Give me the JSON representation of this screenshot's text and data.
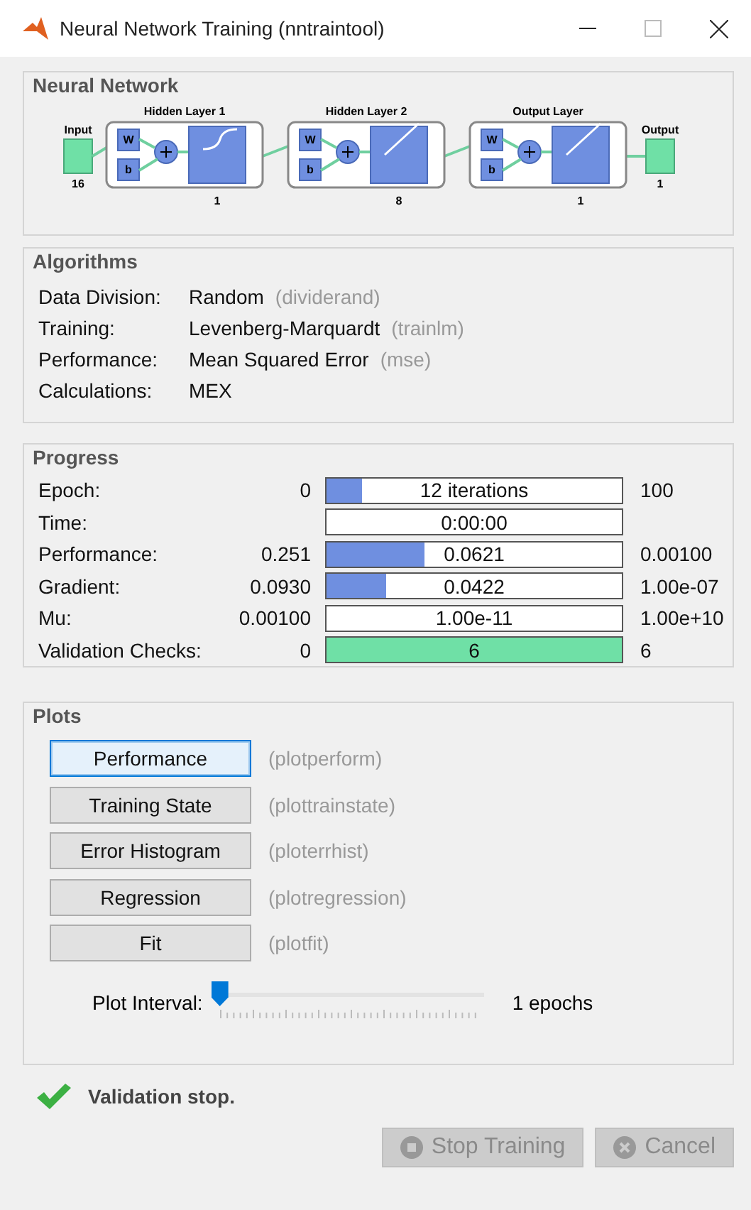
{
  "window": {
    "title": "Neural Network Training (nntraintool)"
  },
  "network": {
    "title": "Neural Network",
    "input": {
      "label": "Input",
      "size": "16"
    },
    "layers": [
      {
        "title": "Hidden Layer 1",
        "size": "1",
        "kind": "sigmoid",
        "weight": "W",
        "bias": "b"
      },
      {
        "title": "Hidden Layer 2",
        "size": "8",
        "kind": "linear",
        "weight": "W",
        "bias": "b"
      },
      {
        "title": "Output Layer",
        "size": "1",
        "kind": "linear",
        "weight": "W",
        "bias": "b"
      }
    ],
    "output": {
      "label": "Output",
      "size": "1"
    }
  },
  "algorithms": {
    "title": "Algorithms",
    "rows": [
      {
        "label": "Data Division:",
        "value": "Random",
        "function": "(dividerand)"
      },
      {
        "label": "Training:",
        "value": "Levenberg-Marquardt",
        "function": "(trainlm)"
      },
      {
        "label": "Performance:",
        "value": "Mean Squared Error",
        "function": "(mse)"
      },
      {
        "label": "Calculations:",
        "value": "MEX"
      }
    ]
  },
  "progress": {
    "title": "Progress",
    "rows": [
      {
        "label": "Epoch:",
        "start": "0",
        "value": "12 iterations",
        "end": "100",
        "level": 0.12,
        "color": "#6f8fe0"
      },
      {
        "label": "Time:",
        "value": "0:00:00"
      },
      {
        "label": "Performance:",
        "start": "0.251",
        "value": "0.0621",
        "end": "0.00100",
        "level": 0.33,
        "color": "#6f8fe0"
      },
      {
        "label": "Gradient:",
        "start": "0.0930",
        "value": "0.0422",
        "end": "1.00e-07",
        "level": 0.2,
        "color": "#6f8fe0"
      },
      {
        "label": "Mu:",
        "start": "0.00100",
        "value": "1.00e-11",
        "end": "1.00e+10"
      },
      {
        "label": "Validation Checks:",
        "start": "0",
        "value": "6",
        "end": "6",
        "level": 1,
        "color": "#6fe0a6"
      }
    ]
  },
  "plots": {
    "title": "Plots",
    "buttons": [
      {
        "label": "Performance",
        "function": "(plotperform)",
        "selected": true
      },
      {
        "label": "Training State",
        "function": "(plottrainstate)",
        "selected": false
      },
      {
        "label": "Error Histogram",
        "function": "(ploterrhist)",
        "selected": false
      },
      {
        "label": "Regression",
        "function": "(plotregression)",
        "selected": false
      },
      {
        "label": "Fit",
        "function": "(plotfit)",
        "selected": false
      }
    ],
    "interval": {
      "label": "Plot Interval:",
      "level": 0,
      "reading": "1 epochs"
    }
  },
  "status": "Validation stop.",
  "buttons": [
    {
      "label": "Stop Training",
      "disabled": true,
      "kind": "stop"
    },
    {
      "label": "Cancel",
      "disabled": true,
      "kind": "cancel"
    }
  ]
}
